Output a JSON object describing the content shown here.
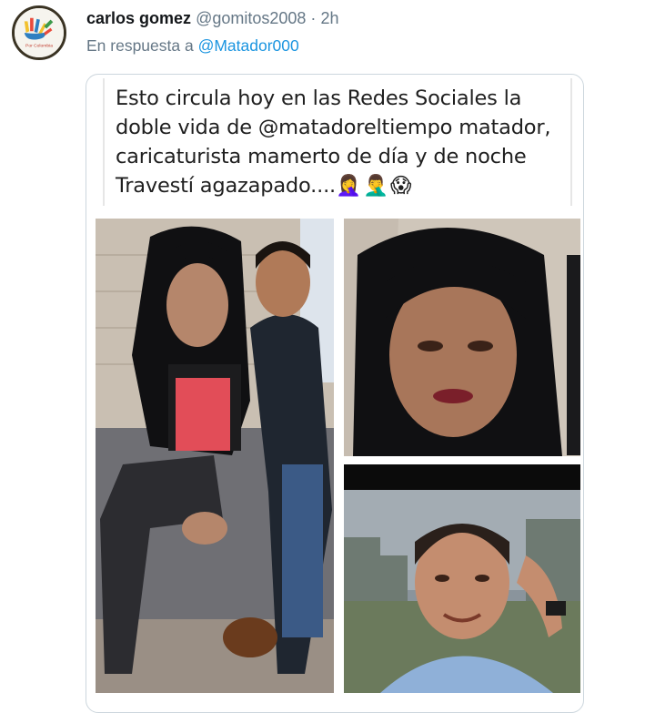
{
  "tweet": {
    "author_name": "carlos gomez",
    "author_handle": "@gomitos2008",
    "separator": "·",
    "time": "2h",
    "reply_prefix": "En respuesta a",
    "reply_mention": "@Matador000",
    "avatar_label": "Por Colombia"
  },
  "quoted_image": {
    "text_lines": [
      "Esto circula hoy en las Redes Sociales la",
      "doble vida de @matadoreltiempo matador,",
      "caricaturista mamerto de día y de noche",
      "Travestí agazapado...."
    ],
    "emojis": "🤦‍♀️🤦‍♂️😱",
    "photos": [
      {
        "name": "photo-couple"
      },
      {
        "name": "photo-closeup-face"
      },
      {
        "name": "photo-man-portrait"
      }
    ]
  },
  "colors": {
    "link": "#1b95e0",
    "muted": "#657786",
    "border": "#ccd6dd"
  }
}
